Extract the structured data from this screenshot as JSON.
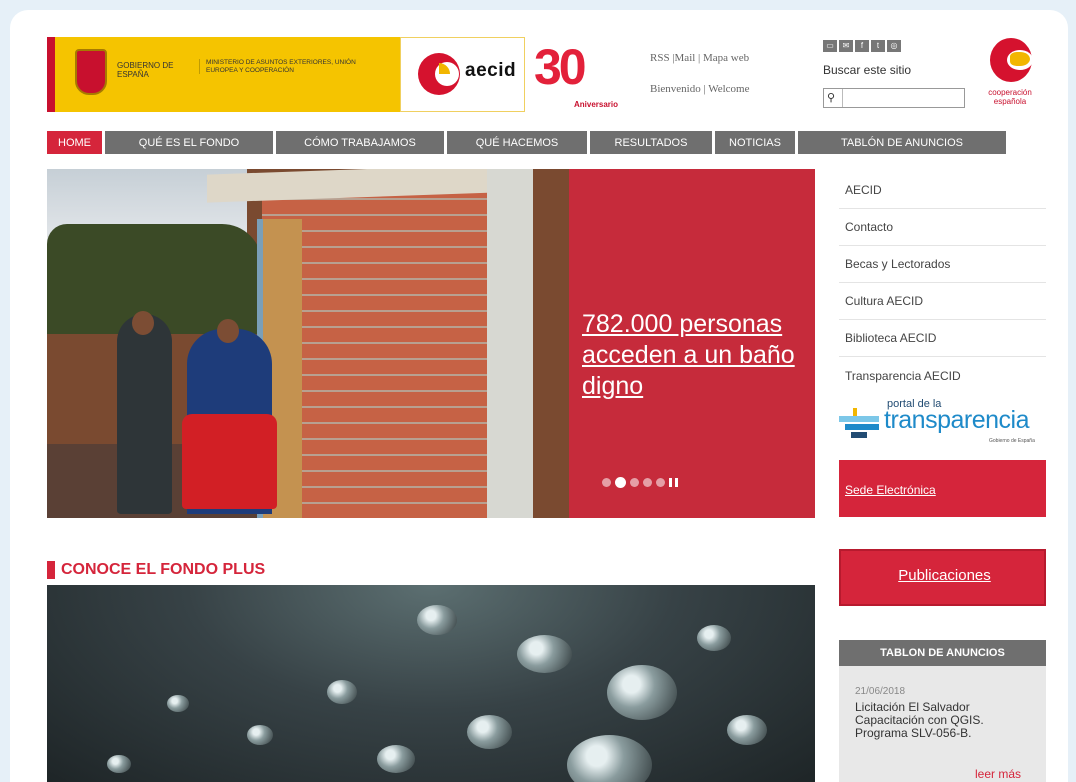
{
  "header": {
    "gobierno": "GOBIERNO DE ESPAÑA",
    "ministerio": "MINISTERIO DE ASUNTOS EXTERIORES, UNIÓN EUROPEA Y COOPERACIÓN",
    "aecid_logo": "aecid",
    "anniversary_number": "30",
    "anniversary_label": "Aniversario",
    "top_links": "RSS |Mail | Mapa web",
    "lang_links": "Bienvenido | Welcome",
    "search_label": "Buscar este sitio",
    "search_placeholder": "",
    "social_icons": [
      "print-icon",
      "email-icon",
      "facebook-icon",
      "twitter-icon",
      "flickr-icon"
    ],
    "coop_logo_text": "cooperación española"
  },
  "nav": {
    "items": [
      {
        "label": "HOME",
        "active": true
      },
      {
        "label": "QUÉ ES EL FONDO"
      },
      {
        "label": "CÓMO TRABAJAMOS"
      },
      {
        "label": "QUÉ HACEMOS"
      },
      {
        "label": "RESULTADOS"
      },
      {
        "label": "NOTICIAS"
      },
      {
        "label": "TABLÓN DE ANUNCIOS"
      }
    ]
  },
  "hero": {
    "headline": "782.000 personas acceden a un baño digno",
    "slide_count": 6,
    "active_slide": 2
  },
  "section": {
    "title": "CONOCE EL FONDO PLUS"
  },
  "sidebar": {
    "links": [
      "AECID",
      "Contacto",
      "Becas y Lectorados",
      "Cultura AECID",
      "Biblioteca AECID",
      "Transparencia AECID"
    ],
    "portal_small": "portal de la",
    "portal_big": "transparencia",
    "portal_sub": "Gobierno de España",
    "sede": "Sede Electrónica",
    "publicaciones": "Publicaciones"
  },
  "tablon": {
    "title": "TABLON DE ANUNCIOS",
    "date": "21/06/2018",
    "text": "Licitación El Salvador Capacitación con QGIS. Programa SLV-056-B.",
    "more": "leer más"
  },
  "colors": {
    "brand_red": "#d5253b",
    "nav_gray": "#6f6f6f",
    "gov_yellow": "#f5c400",
    "transparency_blue": "#1e8ac9"
  }
}
